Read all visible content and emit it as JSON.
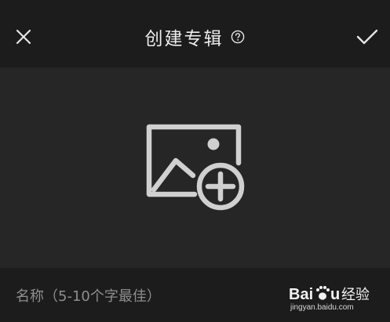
{
  "header": {
    "title": "创建专辑",
    "close_icon": "close-icon",
    "help_icon": "help-circle-icon",
    "confirm_icon": "checkmark-icon"
  },
  "cover": {
    "icon": "add-photo-icon"
  },
  "name_field": {
    "placeholder": "名称（5-10个字最佳）",
    "value": ""
  },
  "watermark": {
    "text": "Baidu经验",
    "url_text": "jingyan.baidu.com"
  },
  "colors": {
    "header_bg": "#1c1c1c",
    "body_bg": "#262626",
    "icon": "#e5e5e5",
    "placeholder": "#8e8e8e"
  }
}
